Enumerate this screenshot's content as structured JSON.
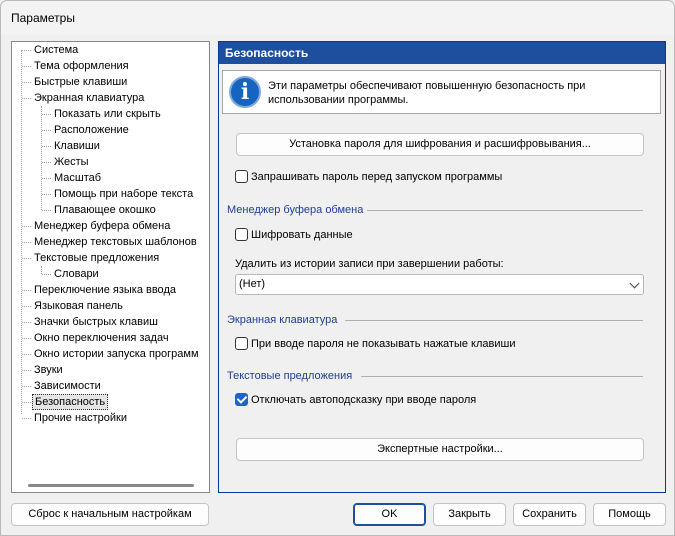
{
  "window": {
    "title": "Параметры"
  },
  "tree": {
    "items": [
      {
        "label": "Система"
      },
      {
        "label": "Тема оформления"
      },
      {
        "label": "Быстрые клавиши"
      },
      {
        "label": "Экранная клавиатура"
      },
      {
        "label": "Показать или скрыть"
      },
      {
        "label": "Расположение"
      },
      {
        "label": "Клавиши"
      },
      {
        "label": "Жесты"
      },
      {
        "label": "Масштаб"
      },
      {
        "label": "Помощь при наборе текста"
      },
      {
        "label": "Плавающее окошко"
      },
      {
        "label": "Менеджер буфера обмена"
      },
      {
        "label": "Менеджер текстовых шаблонов"
      },
      {
        "label": "Текстовые предложения"
      },
      {
        "label": "Словари"
      },
      {
        "label": "Переключение языка ввода"
      },
      {
        "label": "Языковая панель"
      },
      {
        "label": "Значки быстрых клавиш"
      },
      {
        "label": "Окно переключения задач"
      },
      {
        "label": "Окно истории запуска программ"
      },
      {
        "label": "Звуки"
      },
      {
        "label": "Зависимости"
      },
      {
        "label": "Безопасность"
      },
      {
        "label": "Прочие настройки"
      }
    ]
  },
  "panel": {
    "header": "Безопасность",
    "info": "Эти параметры обеспечивают повышенную безопасность при использовании программы.",
    "password_button": "Установка пароля для шифрования и расшифровывания...",
    "ask_password": {
      "label": "Запрашивать пароль перед запуском программы",
      "checked": false
    },
    "clipboard_section": "Менеджер буфера обмена",
    "encrypt_data": {
      "label": "Шифровать данные",
      "checked": false
    },
    "delete_history_label": "Удалить из истории записи при завершении работы:",
    "delete_history_value": "(Нет)",
    "keyboard_section": "Экранная клавиатура",
    "hide_keys": {
      "label": "При вводе пароля не показывать нажатые клавиши",
      "checked": false
    },
    "suggestions_section": "Текстовые предложения",
    "disable_autosuggest": {
      "label": "Отключать автоподсказку при вводе пароля",
      "checked": true
    },
    "expert_button": "Экспертные настройки..."
  },
  "footer": {
    "reset": "Сброс к начальным настройкам",
    "ok": "OK",
    "close": "Закрыть",
    "save": "Сохранить",
    "help": "Помощь"
  }
}
